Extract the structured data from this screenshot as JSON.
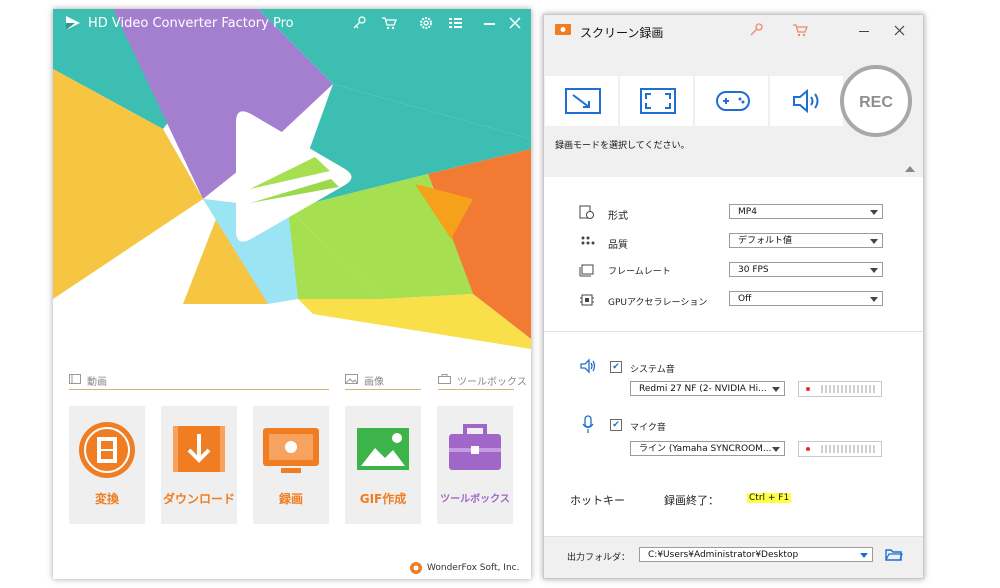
{
  "left_app": {
    "title": "HD Video Converter Factory Pro",
    "sections": {
      "video": "動画",
      "image": "画像",
      "toolbox": "ツールボックス"
    },
    "cards": [
      {
        "label": "変換",
        "color": "#f07d22"
      },
      {
        "label": "ダウンロード",
        "color": "#f07d22"
      },
      {
        "label": "録画",
        "color": "#f07d22"
      },
      {
        "label": "GIF作成",
        "color": "#f07d22"
      },
      {
        "label": "ツールボックス",
        "color": "#a066c8"
      }
    ],
    "footer": "WonderFox Soft, Inc.",
    "colors": {
      "teal": "#3cbfb2",
      "purple": "#a57fcf",
      "yellow": "#f6c542",
      "green": "#a6e050",
      "orange": "#f27b33",
      "accent": "#f07d22"
    }
  },
  "right_app": {
    "title": "スクリーン録画",
    "rec_label": "REC",
    "hint": "録画モードを選択してください。",
    "settings": [
      {
        "label": "形式",
        "value": "MP4"
      },
      {
        "label": "品質",
        "value": "デフォルト値"
      },
      {
        "label": "フレームレート",
        "value": "30 FPS"
      },
      {
        "label": "GPUアクセラレーション",
        "value": "Off"
      }
    ],
    "audio": {
      "system_label": "システム音",
      "system_device": "Redmi 27 NF (2- NVIDIA Hi...",
      "mic_label": "マイク音",
      "mic_device": "ライン (Yamaha SYNCROOM..."
    },
    "hotkey": {
      "label": "ホットキー",
      "action": "録画終了：",
      "keys": "Ctrl + F1"
    },
    "output": {
      "label": "出力フォルダ：",
      "path": "C:¥Users¥Administrator¥Desktop"
    },
    "colors": {
      "header_bg": "#f0f0f0",
      "body_bg": "#ffffff",
      "highlight": "#ffff44",
      "icon_blue": "#1e6fd0"
    }
  }
}
